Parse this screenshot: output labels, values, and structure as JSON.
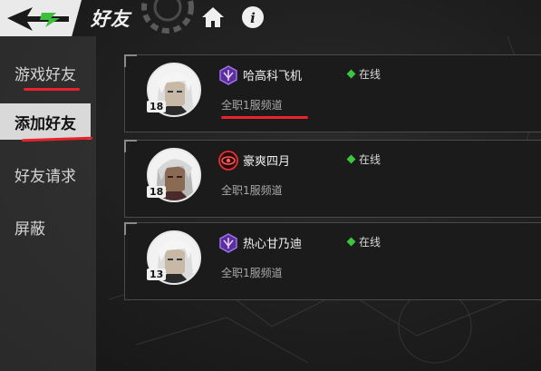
{
  "header": {
    "title": "好友",
    "back_icon": "back-arrow-icon",
    "home_icon": "home-icon",
    "info_icon": "info-icon"
  },
  "sidebar": {
    "items": [
      {
        "label": "游戏好友",
        "underlined": true
      },
      {
        "label": "添加好友",
        "active": true,
        "underlined": true
      },
      {
        "label": "好友请求"
      },
      {
        "label": "屏蔽"
      }
    ]
  },
  "friends": [
    {
      "name": "哈高科飞机",
      "level": "18",
      "status": "在线",
      "channel": "全职1服频道",
      "rank": "purple-rank-icon",
      "channel_underlined": true
    },
    {
      "name": "豪爽四月",
      "level": "18",
      "status": "在线",
      "channel": "全职1服频道",
      "rank": "red-eye-rank-icon"
    },
    {
      "name": "热心甘乃迪",
      "level": "13",
      "status": "在线",
      "channel": "全职1服频道",
      "rank": "purple-rank-icon"
    }
  ],
  "colors": {
    "accent_red": "#e8232b",
    "online_green": "#3ec43e",
    "rank_purple": "#8a4fd8",
    "rank_red": "#e03030"
  }
}
